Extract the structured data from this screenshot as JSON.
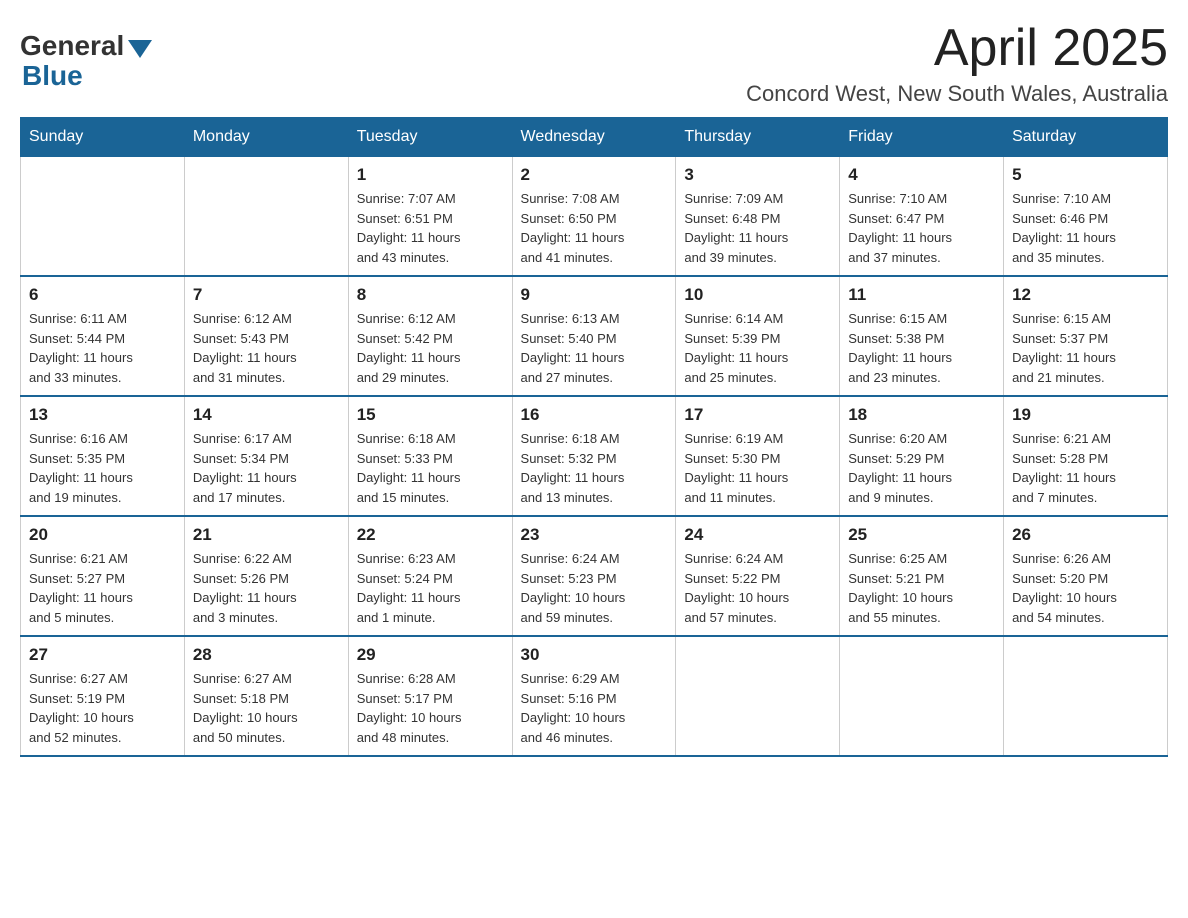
{
  "logo": {
    "general": "General",
    "blue": "Blue"
  },
  "title": "April 2025",
  "location": "Concord West, New South Wales, Australia",
  "days_of_week": [
    "Sunday",
    "Monday",
    "Tuesday",
    "Wednesday",
    "Thursday",
    "Friday",
    "Saturday"
  ],
  "weeks": [
    [
      {
        "day": "",
        "info": ""
      },
      {
        "day": "",
        "info": ""
      },
      {
        "day": "1",
        "info": "Sunrise: 7:07 AM\nSunset: 6:51 PM\nDaylight: 11 hours\nand 43 minutes."
      },
      {
        "day": "2",
        "info": "Sunrise: 7:08 AM\nSunset: 6:50 PM\nDaylight: 11 hours\nand 41 minutes."
      },
      {
        "day": "3",
        "info": "Sunrise: 7:09 AM\nSunset: 6:48 PM\nDaylight: 11 hours\nand 39 minutes."
      },
      {
        "day": "4",
        "info": "Sunrise: 7:10 AM\nSunset: 6:47 PM\nDaylight: 11 hours\nand 37 minutes."
      },
      {
        "day": "5",
        "info": "Sunrise: 7:10 AM\nSunset: 6:46 PM\nDaylight: 11 hours\nand 35 minutes."
      }
    ],
    [
      {
        "day": "6",
        "info": "Sunrise: 6:11 AM\nSunset: 5:44 PM\nDaylight: 11 hours\nand 33 minutes."
      },
      {
        "day": "7",
        "info": "Sunrise: 6:12 AM\nSunset: 5:43 PM\nDaylight: 11 hours\nand 31 minutes."
      },
      {
        "day": "8",
        "info": "Sunrise: 6:12 AM\nSunset: 5:42 PM\nDaylight: 11 hours\nand 29 minutes."
      },
      {
        "day": "9",
        "info": "Sunrise: 6:13 AM\nSunset: 5:40 PM\nDaylight: 11 hours\nand 27 minutes."
      },
      {
        "day": "10",
        "info": "Sunrise: 6:14 AM\nSunset: 5:39 PM\nDaylight: 11 hours\nand 25 minutes."
      },
      {
        "day": "11",
        "info": "Sunrise: 6:15 AM\nSunset: 5:38 PM\nDaylight: 11 hours\nand 23 minutes."
      },
      {
        "day": "12",
        "info": "Sunrise: 6:15 AM\nSunset: 5:37 PM\nDaylight: 11 hours\nand 21 minutes."
      }
    ],
    [
      {
        "day": "13",
        "info": "Sunrise: 6:16 AM\nSunset: 5:35 PM\nDaylight: 11 hours\nand 19 minutes."
      },
      {
        "day": "14",
        "info": "Sunrise: 6:17 AM\nSunset: 5:34 PM\nDaylight: 11 hours\nand 17 minutes."
      },
      {
        "day": "15",
        "info": "Sunrise: 6:18 AM\nSunset: 5:33 PM\nDaylight: 11 hours\nand 15 minutes."
      },
      {
        "day": "16",
        "info": "Sunrise: 6:18 AM\nSunset: 5:32 PM\nDaylight: 11 hours\nand 13 minutes."
      },
      {
        "day": "17",
        "info": "Sunrise: 6:19 AM\nSunset: 5:30 PM\nDaylight: 11 hours\nand 11 minutes."
      },
      {
        "day": "18",
        "info": "Sunrise: 6:20 AM\nSunset: 5:29 PM\nDaylight: 11 hours\nand 9 minutes."
      },
      {
        "day": "19",
        "info": "Sunrise: 6:21 AM\nSunset: 5:28 PM\nDaylight: 11 hours\nand 7 minutes."
      }
    ],
    [
      {
        "day": "20",
        "info": "Sunrise: 6:21 AM\nSunset: 5:27 PM\nDaylight: 11 hours\nand 5 minutes."
      },
      {
        "day": "21",
        "info": "Sunrise: 6:22 AM\nSunset: 5:26 PM\nDaylight: 11 hours\nand 3 minutes."
      },
      {
        "day": "22",
        "info": "Sunrise: 6:23 AM\nSunset: 5:24 PM\nDaylight: 11 hours\nand 1 minute."
      },
      {
        "day": "23",
        "info": "Sunrise: 6:24 AM\nSunset: 5:23 PM\nDaylight: 10 hours\nand 59 minutes."
      },
      {
        "day": "24",
        "info": "Sunrise: 6:24 AM\nSunset: 5:22 PM\nDaylight: 10 hours\nand 57 minutes."
      },
      {
        "day": "25",
        "info": "Sunrise: 6:25 AM\nSunset: 5:21 PM\nDaylight: 10 hours\nand 55 minutes."
      },
      {
        "day": "26",
        "info": "Sunrise: 6:26 AM\nSunset: 5:20 PM\nDaylight: 10 hours\nand 54 minutes."
      }
    ],
    [
      {
        "day": "27",
        "info": "Sunrise: 6:27 AM\nSunset: 5:19 PM\nDaylight: 10 hours\nand 52 minutes."
      },
      {
        "day": "28",
        "info": "Sunrise: 6:27 AM\nSunset: 5:18 PM\nDaylight: 10 hours\nand 50 minutes."
      },
      {
        "day": "29",
        "info": "Sunrise: 6:28 AM\nSunset: 5:17 PM\nDaylight: 10 hours\nand 48 minutes."
      },
      {
        "day": "30",
        "info": "Sunrise: 6:29 AM\nSunset: 5:16 PM\nDaylight: 10 hours\nand 46 minutes."
      },
      {
        "day": "",
        "info": ""
      },
      {
        "day": "",
        "info": ""
      },
      {
        "day": "",
        "info": ""
      }
    ]
  ]
}
